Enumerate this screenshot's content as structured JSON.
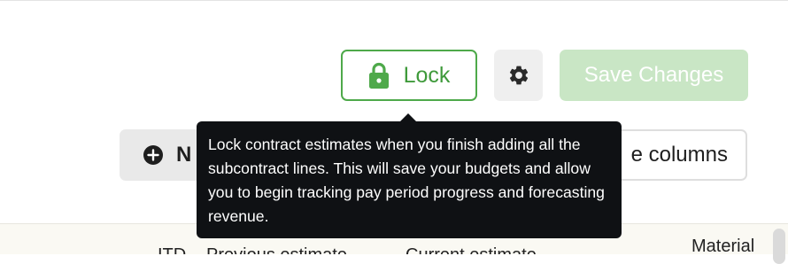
{
  "toolbar": {
    "lock_label": "Lock",
    "save_label": "Save Changes"
  },
  "actions": {
    "new_label": "N",
    "columns_label": "e columns"
  },
  "tooltip": {
    "text": "Lock contract estimates when you finish adding all the subcontract lines. This will save your budgets and allow you to begin tracking pay period progress and forecasting revenue."
  },
  "table": {
    "headers": [
      "ITD",
      "Previous estimate",
      "Current estimate",
      "Material"
    ]
  },
  "icons": {
    "lock": "lock-icon",
    "settings": "gear-icon",
    "add": "plus-circle-icon"
  },
  "colors": {
    "accent": "#4ea94a",
    "save_disabled": "#c9e6c5",
    "tooltip_bg": "#0f1114"
  }
}
